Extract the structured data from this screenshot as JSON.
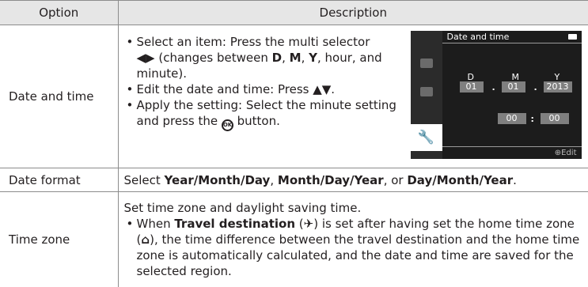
{
  "header": {
    "option": "Option",
    "description": "Description"
  },
  "date_time": {
    "option": "Date and time",
    "b1_pre": "Select an item: Press the multi selector",
    "b1_arrows": "◀▶",
    "b1_mid": " (changes between ",
    "b1_d": "D",
    "b1_c1": ", ",
    "b1_m": "M",
    "b1_c2": ", ",
    "b1_y": "Y",
    "b1_post": ", hour, and minute).",
    "b2": "Edit the date and time: Press ▲▼.",
    "b3_pre": "Apply the setting: Select the minute setting and press the ",
    "b3_ok": "OK",
    "b3_post": " button.",
    "screen": {
      "title": "Date and time",
      "label_d": "D",
      "label_m": "M",
      "label_y": "Y",
      "day": "01",
      "month": "01",
      "year": "2013",
      "dot1": ".",
      "dot2": ".",
      "hour": "00",
      "colon": ":",
      "minute": "00",
      "edit": "Edit"
    }
  },
  "date_format": {
    "option": "Date format",
    "pre": "Select ",
    "f1": "Year/Month/Day",
    "c1": ", ",
    "f2": "Month/Day/Year",
    "c2": ", or ",
    "f3": "Day/Month/Year",
    "post": "."
  },
  "time_zone": {
    "option": "Time zone",
    "intro": "Set time zone and daylight saving time.",
    "when": "When ",
    "travel": "Travel destination",
    "p1": " (",
    "plane": "✈",
    "p2": ") is set after having set the home time zone (",
    "home": "⌂",
    "p3": "), the time difference between the travel destination and the home time zone is automatically calculated, and the date and time are saved for the selected region."
  }
}
